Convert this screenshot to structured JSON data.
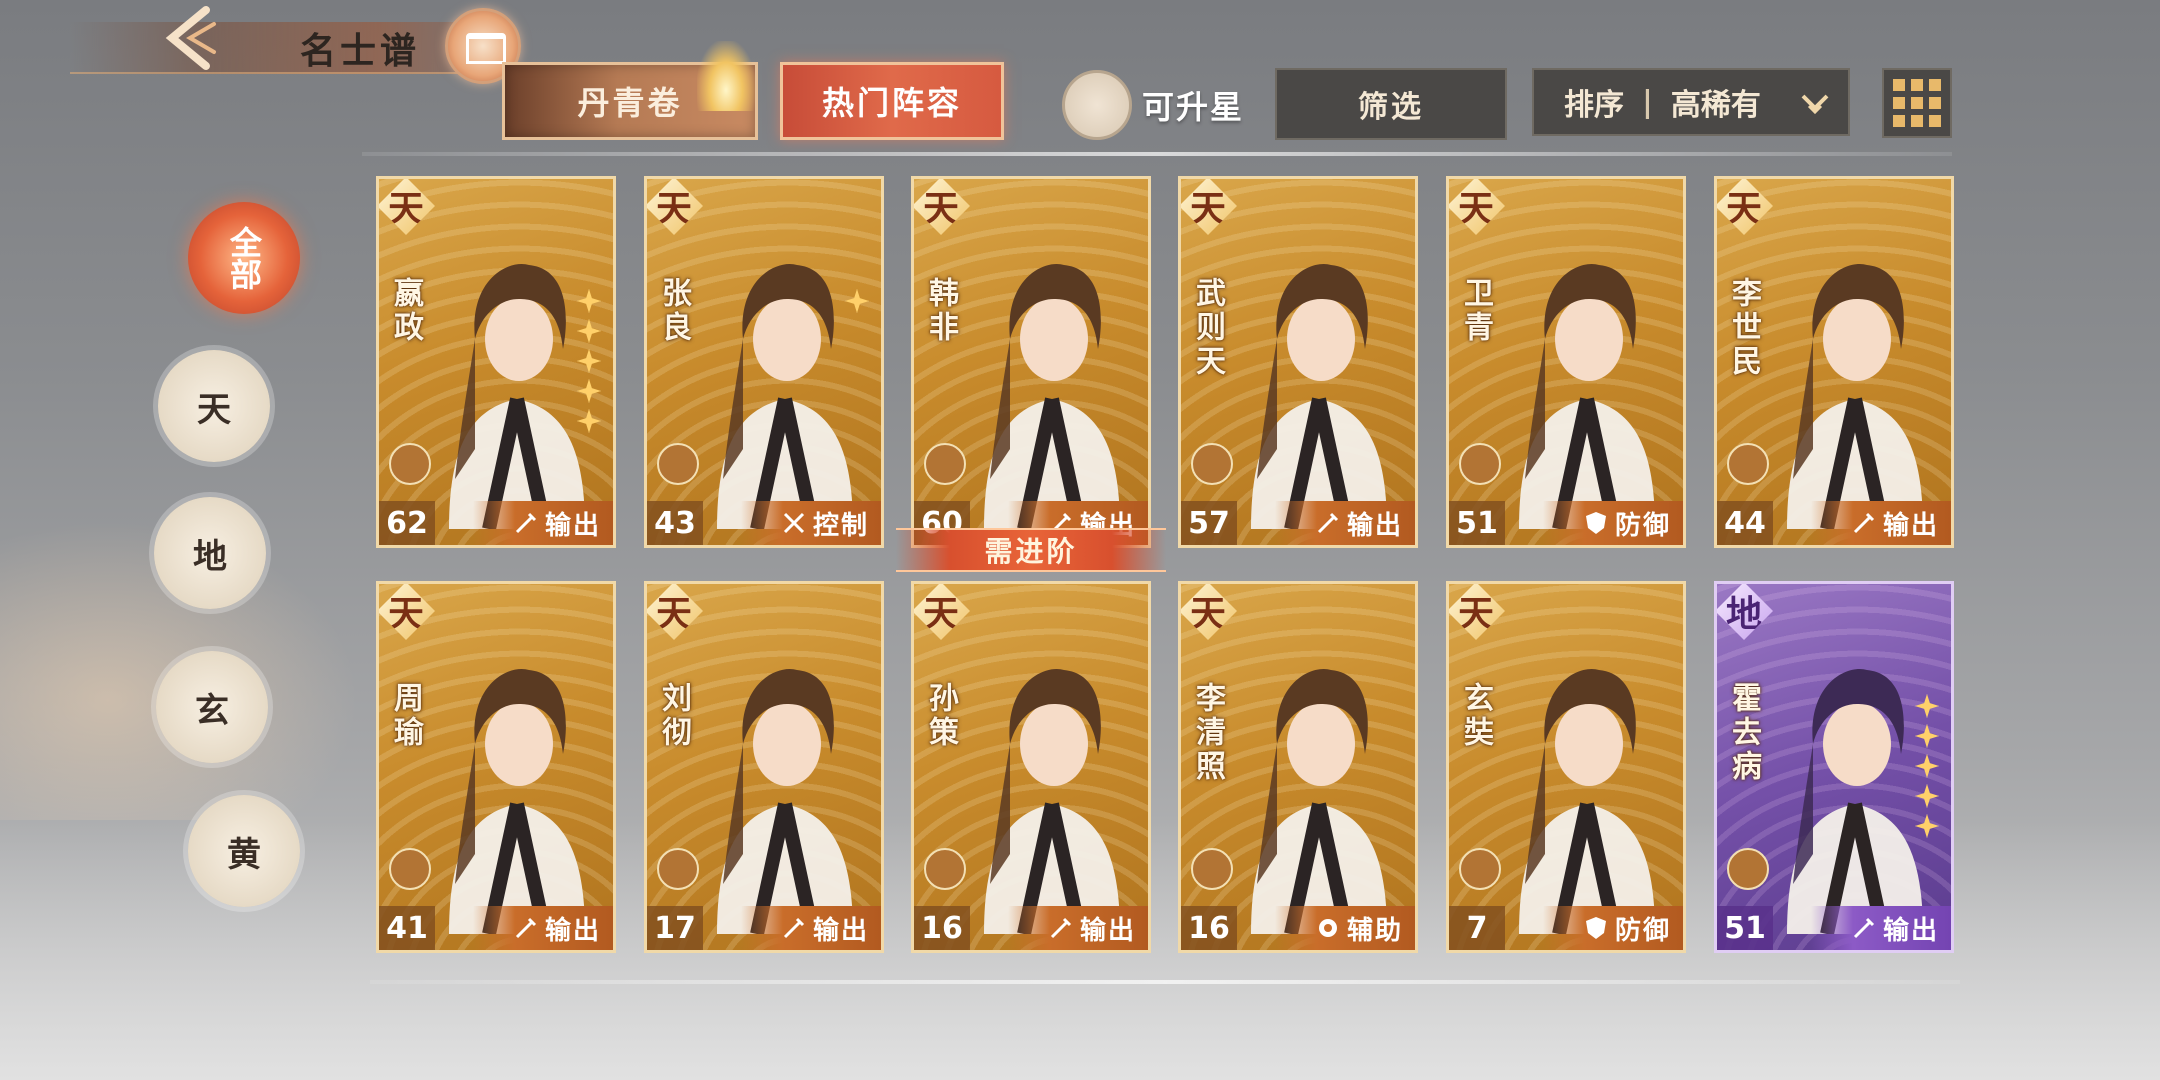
{
  "header": {
    "title": "名士谱"
  },
  "tabs": {
    "danqing": "丹青卷",
    "hot_lineup": "热门阵容"
  },
  "toolbar": {
    "upgradable_label": "可升星",
    "filter_label": "筛选",
    "sort_label": "排序",
    "sort_separator": "|",
    "sort_value": "高稀有"
  },
  "categories": [
    {
      "label": "全部",
      "selected": true
    },
    {
      "label": "天"
    },
    {
      "label": "地"
    },
    {
      "label": "玄"
    },
    {
      "label": "黄"
    }
  ],
  "banner": {
    "need_advance": "需进阶"
  },
  "cards": [
    {
      "rank": "天",
      "name": "嬴政",
      "level": "62",
      "role": "输出",
      "stars": 5,
      "tone": "gold"
    },
    {
      "rank": "天",
      "name": "张良",
      "level": "43",
      "role": "控制",
      "stars": 1,
      "tone": "gold"
    },
    {
      "rank": "天",
      "name": "韩非",
      "level": "60",
      "role": "输出",
      "stars": 0,
      "tone": "gold"
    },
    {
      "rank": "天",
      "name": "武则天",
      "level": "57",
      "role": "输出",
      "stars": 0,
      "tone": "gold"
    },
    {
      "rank": "天",
      "name": "卫青",
      "level": "51",
      "role": "防御",
      "stars": 0,
      "tone": "gold"
    },
    {
      "rank": "天",
      "name": "李世民",
      "level": "44",
      "role": "输出",
      "stars": 0,
      "tone": "gold"
    },
    {
      "rank": "天",
      "name": "周瑜",
      "level": "41",
      "role": "输出",
      "stars": 0,
      "tone": "gold"
    },
    {
      "rank": "天",
      "name": "刘彻",
      "level": "17",
      "role": "输出",
      "stars": 0,
      "tone": "gold"
    },
    {
      "rank": "天",
      "name": "孙策",
      "level": "16",
      "role": "输出",
      "stars": 0,
      "tone": "gold"
    },
    {
      "rank": "天",
      "name": "李清照",
      "level": "16",
      "role": "辅助",
      "stars": 0,
      "tone": "gold"
    },
    {
      "rank": "天",
      "name": "玄奘",
      "level": "7",
      "role": "防御",
      "stars": 0,
      "tone": "gold"
    },
    {
      "rank": "地",
      "name": "霍去病",
      "level": "51",
      "role": "输出",
      "stars": 5,
      "tone": "purple"
    }
  ]
}
